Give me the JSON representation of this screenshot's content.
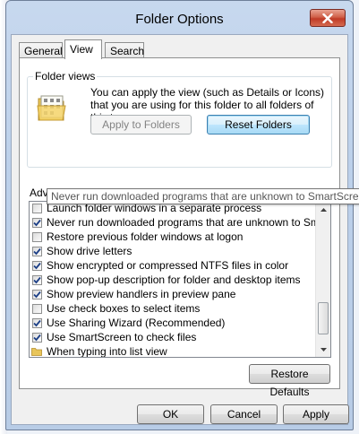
{
  "window": {
    "title": "Folder Options",
    "close_icon": "close-icon"
  },
  "tabs": [
    {
      "label": "General",
      "active": false
    },
    {
      "label": "View",
      "active": true
    },
    {
      "label": "Search",
      "active": false
    }
  ],
  "folder_views": {
    "label": "Folder views",
    "description": "You can apply the view (such as Details or Icons) that you are using for this folder to all folders of this type.",
    "icon": "folder-views-icon",
    "apply_button": "Apply to Folders",
    "apply_enabled": false,
    "reset_button": "Reset Folders"
  },
  "advanced": {
    "label": "Advanced settings:",
    "items": [
      {
        "label": "Launch folder windows in a separate process",
        "checked": false
      },
      {
        "label": "Never run downloaded programs that are unknown to SmartScreen",
        "checked": true
      },
      {
        "label": "Restore previous folder windows at logon",
        "checked": false
      },
      {
        "label": "Show drive letters",
        "checked": true
      },
      {
        "label": "Show encrypted or compressed NTFS files in color",
        "checked": true
      },
      {
        "label": "Show pop-up description for folder and desktop items",
        "checked": true
      },
      {
        "label": "Show preview handlers in preview pane",
        "checked": true
      },
      {
        "label": "Use check boxes to select items",
        "checked": false
      },
      {
        "label": "Use Sharing Wizard (Recommended)",
        "checked": true
      },
      {
        "label": "Use SmartScreen to check files",
        "checked": true
      },
      {
        "label": "When typing into list view",
        "type": "folder"
      }
    ],
    "tooltip": "Never run downloaded programs that are unknown to SmartScreen"
  },
  "restore_defaults": "Restore Defaults",
  "footer": {
    "ok": "OK",
    "cancel": "Cancel",
    "apply": "Apply"
  },
  "colors": {
    "titlebar": "#bcd0ea",
    "close_button": "#c8422c",
    "focus_border": "#3c7fb1"
  }
}
